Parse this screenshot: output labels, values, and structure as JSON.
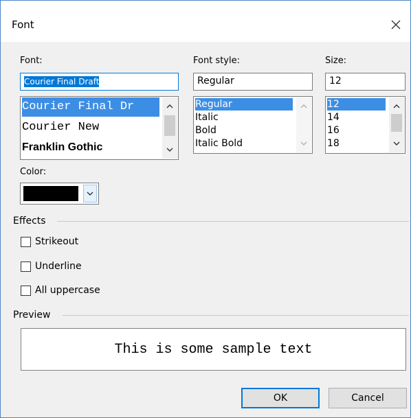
{
  "dialog": {
    "title": "Font",
    "close_icon": "close-icon"
  },
  "font": {
    "label": "Font:",
    "value": "Courier Final Draft",
    "items": [
      {
        "label": "Courier Final Dr",
        "selected": true
      },
      {
        "label": "Courier New",
        "selected": false
      },
      {
        "label": "Franklin Gothic",
        "selected": false
      }
    ]
  },
  "font_style": {
    "label": "Font style:",
    "value": "Regular",
    "items": [
      {
        "label": "Regular",
        "selected": true
      },
      {
        "label": "Italic",
        "selected": false
      },
      {
        "label": "Bold",
        "selected": false
      },
      {
        "label": "Italic Bold",
        "selected": false
      }
    ]
  },
  "size": {
    "label": "Size:",
    "value": "12",
    "items": [
      {
        "label": "12",
        "selected": true
      },
      {
        "label": "14",
        "selected": false
      },
      {
        "label": "16",
        "selected": false
      },
      {
        "label": "18",
        "selected": false
      }
    ]
  },
  "color": {
    "label": "Color:",
    "value": "#000000"
  },
  "effects": {
    "label": "Effects",
    "strikeout": {
      "label": "Strikeout",
      "checked": false
    },
    "underline": {
      "label": "Underline",
      "checked": false
    },
    "uppercase": {
      "label": "All uppercase",
      "checked": false
    }
  },
  "preview": {
    "label": "Preview",
    "text": "This is some sample text"
  },
  "buttons": {
    "ok": "OK",
    "cancel": "Cancel"
  },
  "colors": {
    "accent": "#0078d7",
    "selection": "#3c8ee5",
    "background": "#f0f0f0"
  }
}
